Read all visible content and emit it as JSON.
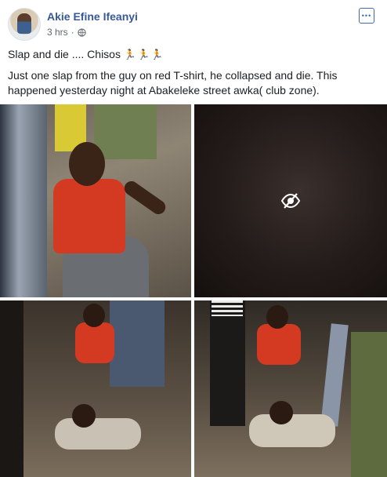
{
  "post": {
    "author": "Akie Efine Ifeanyi",
    "timestamp": "3 hrs",
    "separator": "·",
    "more_label": "•••",
    "text_line1": "Slap and die .... Chisos",
    "text_emoji": "🏃🏃🏃",
    "text_line2": "Just one slap from the guy on red T-shirt, he collapsed and die. This happened yesterday night at Abakeleke street awka( club zone)."
  },
  "icons": {
    "audience": "globe-icon",
    "more": "more-options-icon",
    "hidden_photo": "eye-slash-icon"
  },
  "colors": {
    "author_link": "#385898",
    "meta_text": "#606770",
    "accent": "#4267b2"
  }
}
